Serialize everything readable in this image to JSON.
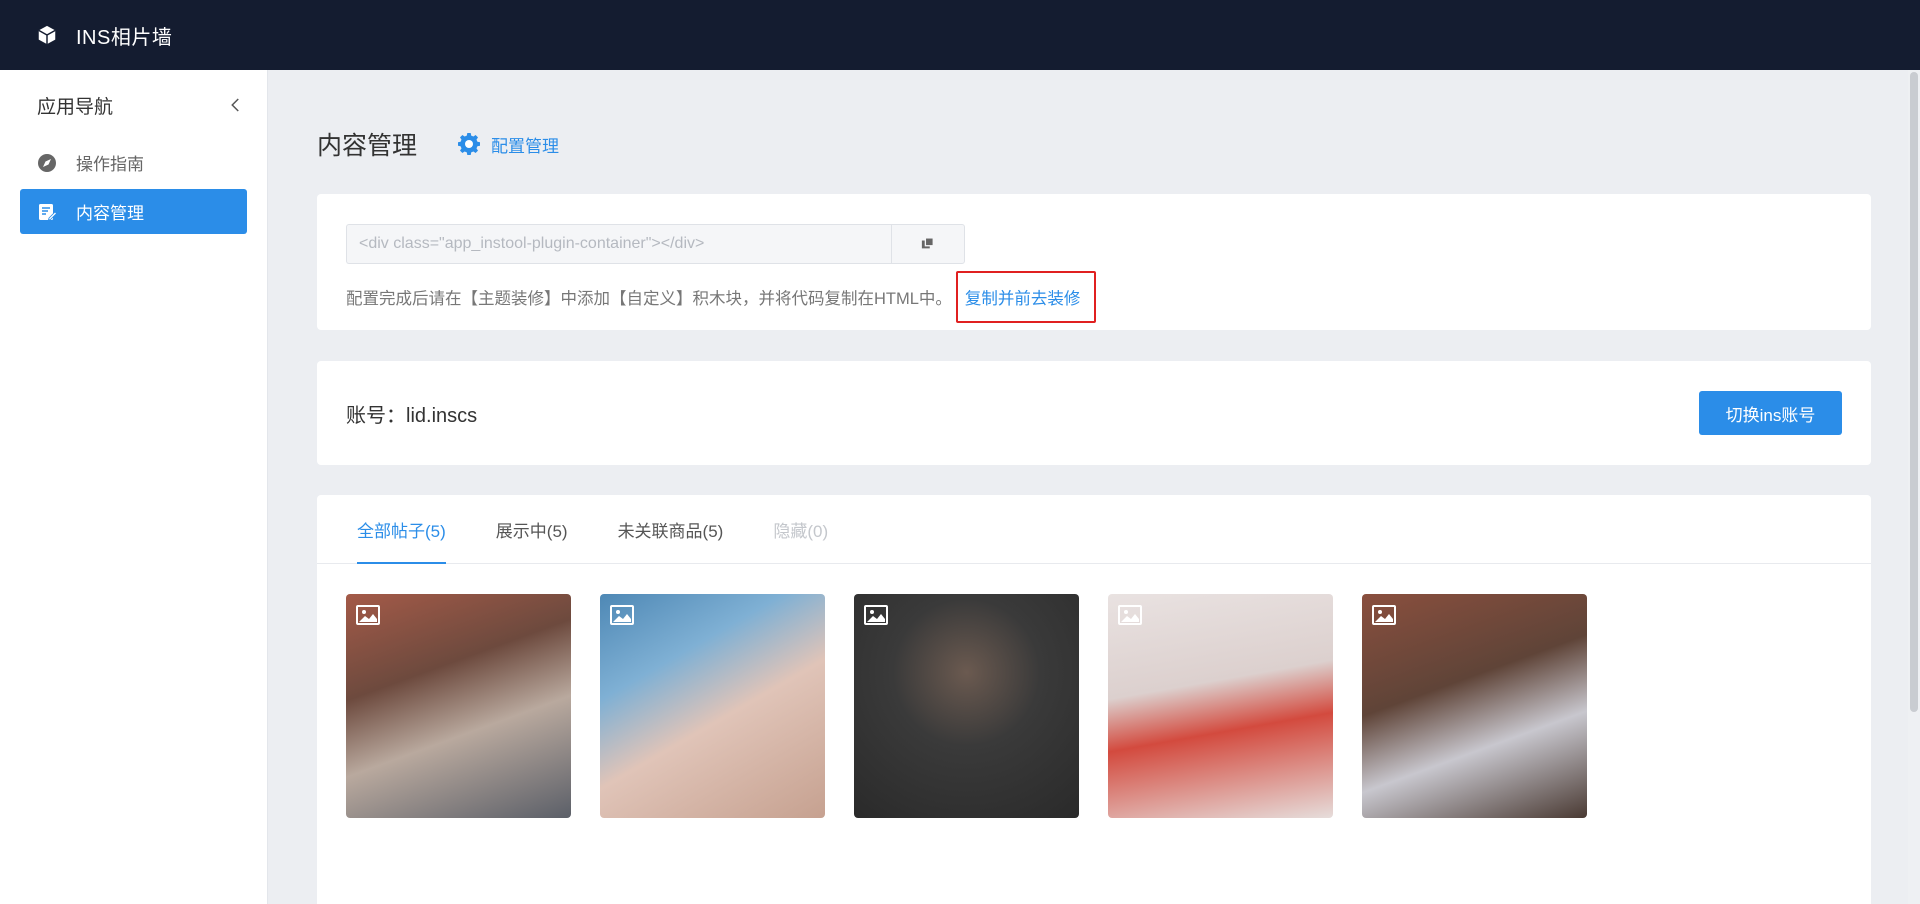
{
  "topbar": {
    "title": "INS相片墙",
    "logo_icon": "cube-icon"
  },
  "sidebar": {
    "title": "应用导航",
    "items": [
      {
        "label": "操作指南",
        "icon": "compass-icon",
        "active": false
      },
      {
        "label": "内容管理",
        "icon": "edit-document-icon",
        "active": true
      }
    ]
  },
  "main": {
    "page_title": "内容管理",
    "config_link": "配置管理",
    "code": {
      "value": "<div class=\"app_instool-plugin-container\"></div>",
      "hint": "配置完成后请在【主题装修】中添加【自定义】积木块，并将代码复制在HTML中。",
      "copy_go_label": "复制并前去装修"
    },
    "account": {
      "label": "账号：lid.inscs",
      "switch_label": "切换ins账号"
    },
    "tabs": [
      {
        "label": "全部帖子(5)",
        "state": "active"
      },
      {
        "label": "展示中(5)",
        "state": "normal"
      },
      {
        "label": "未关联商品(5)",
        "state": "normal"
      },
      {
        "label": "隐藏(0)",
        "state": "disabled"
      }
    ],
    "post_icon": "image-icon"
  },
  "colors": {
    "accent": "#2b8de8",
    "topbar": "#141c30",
    "highlight": "#e02020"
  }
}
